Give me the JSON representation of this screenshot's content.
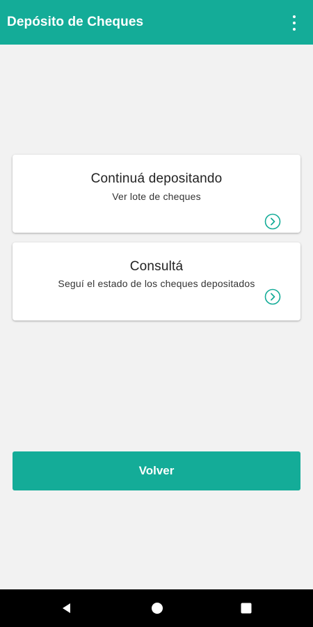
{
  "app_bar": {
    "title": "Depósito de Cheques",
    "menu_icon": "more-vert-icon"
  },
  "cards": [
    {
      "title": "Continuá depositando",
      "subtitle": "Ver lote de cheques",
      "icon": "chevron-right-circle-icon"
    },
    {
      "title": "Consultá",
      "subtitle": "Seguí el estado de los cheques depositados",
      "icon": "chevron-right-circle-icon"
    }
  ],
  "footer": {
    "button_label": "Volver"
  },
  "system_nav": {
    "back_icon": "back-triangle-icon",
    "home_icon": "home-circle-icon",
    "recents_icon": "recents-square-icon"
  },
  "colors": {
    "accent": "#14ac98",
    "background": "#f2f2f2",
    "card": "#ffffff",
    "nav_bar": "#000000"
  }
}
